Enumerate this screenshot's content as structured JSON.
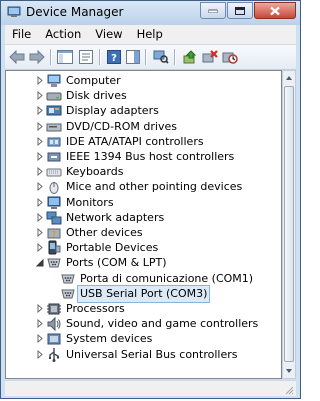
{
  "window": {
    "title": "Device Manager"
  },
  "menu": {
    "items": [
      "File",
      "Action",
      "View",
      "Help"
    ]
  },
  "toolbar": {
    "buttons": [
      "back-icon",
      "forward-icon",
      "show-hide-console-tree-icon",
      "properties-icon",
      "help-icon",
      "show-action-pane-icon",
      "scan-hardware-changes-icon",
      "update-driver-icon",
      "uninstall-icon",
      "disable-icon"
    ]
  },
  "tree": {
    "items": [
      {
        "label": "Computer",
        "icon": "computer-icon",
        "expanded": false
      },
      {
        "label": "Disk drives",
        "icon": "disk-drive-icon",
        "expanded": false
      },
      {
        "label": "Display adapters",
        "icon": "display-adapter-icon",
        "expanded": false
      },
      {
        "label": "DVD/CD-ROM drives",
        "icon": "dvd-drive-icon",
        "expanded": false
      },
      {
        "label": "IDE ATA/ATAPI controllers",
        "icon": "ide-controller-icon",
        "expanded": false
      },
      {
        "label": "IEEE 1394 Bus host controllers",
        "icon": "ieee1394-icon",
        "expanded": false
      },
      {
        "label": "Keyboards",
        "icon": "keyboard-icon",
        "expanded": false
      },
      {
        "label": "Mice and other pointing devices",
        "icon": "mouse-icon",
        "expanded": false
      },
      {
        "label": "Monitors",
        "icon": "monitor-icon",
        "expanded": false
      },
      {
        "label": "Network adapters",
        "icon": "network-adapter-icon",
        "expanded": false
      },
      {
        "label": "Other devices",
        "icon": "other-devices-icon",
        "expanded": false
      },
      {
        "label": "Portable Devices",
        "icon": "portable-device-icon",
        "expanded": false
      },
      {
        "label": "Ports (COM & LPT)",
        "icon": "port-icon",
        "expanded": true,
        "children": [
          {
            "label": "Porta di comunicazione (COM1)",
            "icon": "port-icon",
            "selected": false
          },
          {
            "label": "USB Serial Port (COM3)",
            "icon": "port-icon",
            "selected": true
          }
        ]
      },
      {
        "label": "Processors",
        "icon": "processor-icon",
        "expanded": false
      },
      {
        "label": "Sound, video and game controllers",
        "icon": "sound-icon",
        "expanded": false
      },
      {
        "label": "System devices",
        "icon": "system-device-icon",
        "expanded": false
      },
      {
        "label": "Universal Serial Bus controllers",
        "icon": "usb-controller-icon",
        "expanded": false
      }
    ]
  },
  "colors": {
    "selection": "#dbeaf9",
    "selection_border": "#8ab4e0",
    "titlebar": "#c6d9ef"
  }
}
